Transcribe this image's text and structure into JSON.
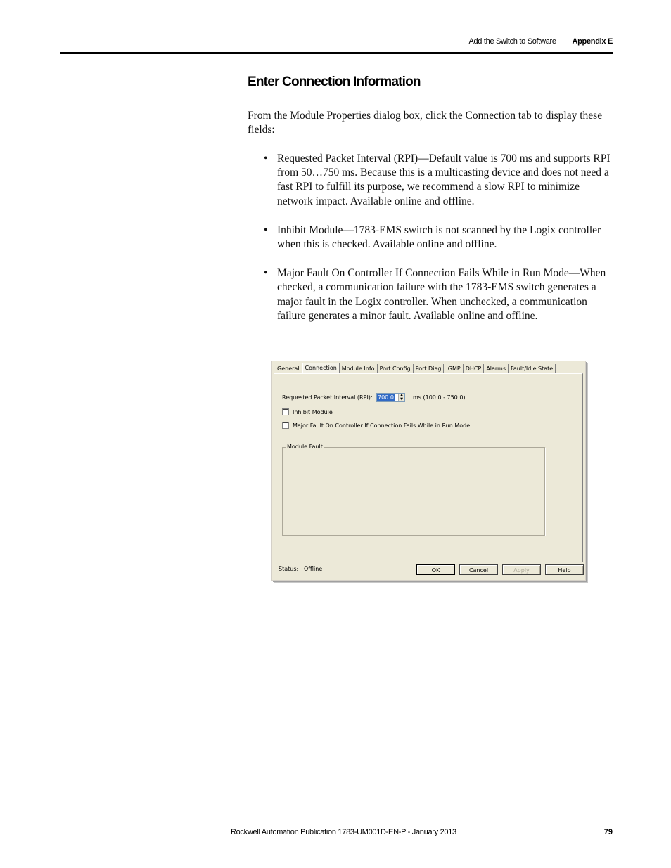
{
  "running_head": {
    "section": "Add the Switch to Software",
    "appendix": "Appendix E"
  },
  "section_title": "Enter Connection Information",
  "intro": "From the Module Properties dialog box, click the Connection tab to display these fields:",
  "bullets": [
    "Requested Packet Interval (RPI)—Default value is 700 ms and supports RPI from 50…750 ms. Because this is a multicasting device and does not need a fast RPI to fulfill its purpose, we recommend a slow RPI to minimize network impact. Available online and offline.",
    "Inhibit Module—1783-EMS switch is not scanned by the Logix controller when this is checked. Available online and offline.",
    "Major Fault On Controller If Connection Fails While in Run Mode—When checked, a communication failure with the 1783-EMS switch generates a major fault in the Logix controller. When unchecked, a communication failure generates a minor fault. Available online and offline."
  ],
  "bullet_glyph": "•",
  "dialog": {
    "tabs": [
      "General",
      "Connection",
      "Module Info",
      "Port Config",
      "Port Diag",
      "IGMP",
      "DHCP",
      "Alarms",
      "Fault/Idle State"
    ],
    "active_tab": "Connection",
    "rpi_label": "Requested Packet Interval (RPI):",
    "rpi_value": "700.0",
    "rpi_range": "ms (100.0 - 750.0)",
    "spin_up": "▲",
    "spin_down": "▼",
    "inhibit_label": "Inhibit Module",
    "inhibit_checked": false,
    "major_fault_label": "Major Fault On Controller If Connection Fails While in Run Mode",
    "major_fault_checked": false,
    "module_fault_label": "Module Fault",
    "status_label": "Status:",
    "status_value": "Offline",
    "buttons": {
      "ok": "OK",
      "cancel": "Cancel",
      "apply": "Apply",
      "help": "Help"
    }
  },
  "footer": {
    "publication": "Rockwell Automation Publication 1783-UM001D-EN-P - January 2013",
    "page_number": "79"
  }
}
